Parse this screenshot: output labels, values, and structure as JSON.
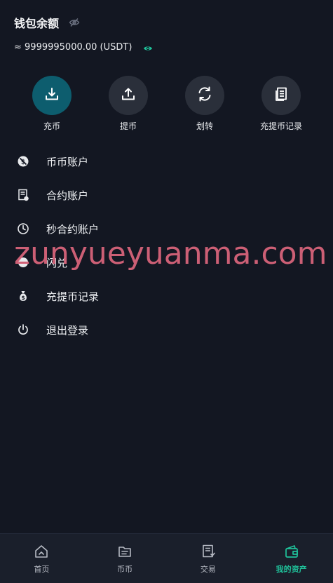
{
  "wallet": {
    "title": "钱包余额",
    "balance": "≈ 9999995000.00 (USDT)"
  },
  "actions": [
    {
      "label": "充币",
      "icon": "download-icon"
    },
    {
      "label": "提币",
      "icon": "upload-icon"
    },
    {
      "label": "划转",
      "icon": "refresh-icon"
    },
    {
      "label": "充提币记录",
      "icon": "document-icon"
    }
  ],
  "menu": [
    {
      "label": "币币账户",
      "icon": "coin-slash-icon"
    },
    {
      "label": "合约账户",
      "icon": "contract-icon"
    },
    {
      "label": "秒合约账户",
      "icon": "clock-icon"
    },
    {
      "label": "闪兑",
      "icon": "swap-icon"
    },
    {
      "label": "充提币记录",
      "icon": "money-bag-icon"
    },
    {
      "label": "退出登录",
      "icon": "power-icon"
    }
  ],
  "watermark": "zunyueyuanma.com",
  "tabs": [
    {
      "label": "首页",
      "icon": "home-icon"
    },
    {
      "label": "币币",
      "icon": "folder-icon"
    },
    {
      "label": "交易",
      "icon": "receipt-icon"
    },
    {
      "label": "我的资产",
      "icon": "wallet-icon",
      "active": true
    }
  ],
  "colors": {
    "background": "#131722",
    "primary_action": "#0d5d6e",
    "accent": "#1fc19a",
    "watermark": "#d6637a"
  }
}
